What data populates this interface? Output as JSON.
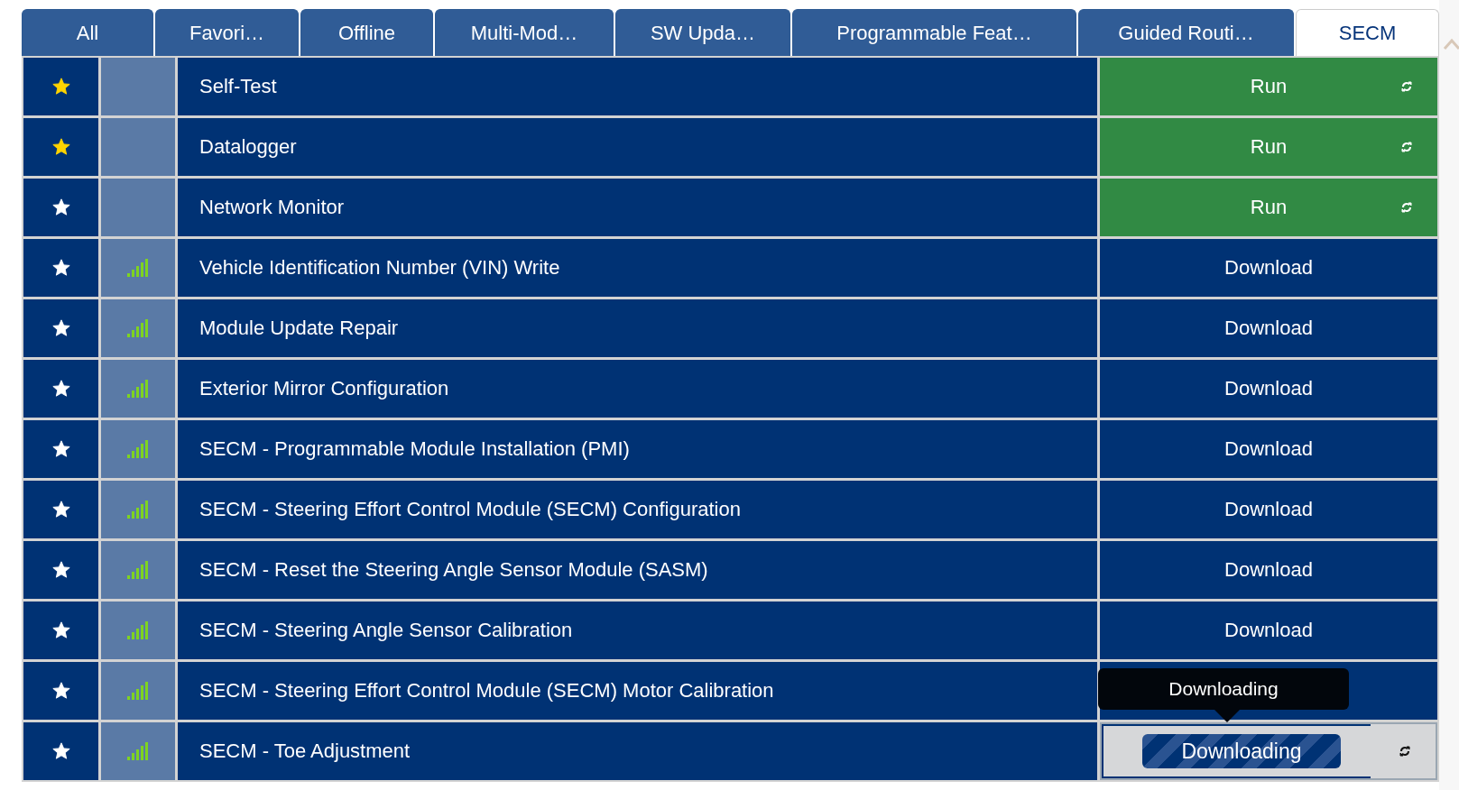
{
  "tabs": [
    {
      "label": "All",
      "selected": false
    },
    {
      "label": "Favori…",
      "selected": false
    },
    {
      "label": "Offline",
      "selected": false
    },
    {
      "label": "Multi-Mod…",
      "selected": false
    },
    {
      "label": "SW Upda…",
      "selected": false
    },
    {
      "label": "Programmable Feat…",
      "selected": false
    },
    {
      "label": "Guided Routi…",
      "selected": false
    },
    {
      "label": "SECM",
      "selected": true
    }
  ],
  "rows": [
    {
      "favorite": true,
      "signal": false,
      "name": "Self-Test",
      "action": {
        "kind": "run",
        "label": "Run"
      }
    },
    {
      "favorite": true,
      "signal": false,
      "name": "Datalogger",
      "action": {
        "kind": "run",
        "label": "Run"
      }
    },
    {
      "favorite": false,
      "signal": false,
      "name": "Network Monitor",
      "action": {
        "kind": "run",
        "label": "Run"
      }
    },
    {
      "favorite": false,
      "signal": true,
      "name": "Vehicle Identification Number (VIN) Write",
      "action": {
        "kind": "download",
        "label": "Download"
      }
    },
    {
      "favorite": false,
      "signal": true,
      "name": "Module Update Repair",
      "action": {
        "kind": "download",
        "label": "Download"
      }
    },
    {
      "favorite": false,
      "signal": true,
      "name": "Exterior Mirror Configuration",
      "action": {
        "kind": "download",
        "label": "Download"
      }
    },
    {
      "favorite": false,
      "signal": true,
      "name": "SECM - Programmable Module Installation (PMI)",
      "action": {
        "kind": "download",
        "label": "Download"
      }
    },
    {
      "favorite": false,
      "signal": true,
      "name": "SECM - Steering Effort Control Module (SECM) Configuration",
      "action": {
        "kind": "download",
        "label": "Download"
      }
    },
    {
      "favorite": false,
      "signal": true,
      "name": "SECM - Reset the Steering Angle Sensor Module (SASM)",
      "action": {
        "kind": "download",
        "label": "Download"
      }
    },
    {
      "favorite": false,
      "signal": true,
      "name": "SECM - Steering Angle Sensor Calibration",
      "action": {
        "kind": "download",
        "label": "Download"
      }
    },
    {
      "favorite": false,
      "signal": true,
      "name": "SECM - Steering Effort Control Module (SECM) Motor Calibration",
      "action": {
        "kind": "covered"
      }
    },
    {
      "favorite": false,
      "signal": true,
      "name": "SECM - Toe Adjustment",
      "action": {
        "kind": "downloading",
        "label": "Downloading",
        "tooltip": "Downloading",
        "level": 0.8
      }
    }
  ]
}
